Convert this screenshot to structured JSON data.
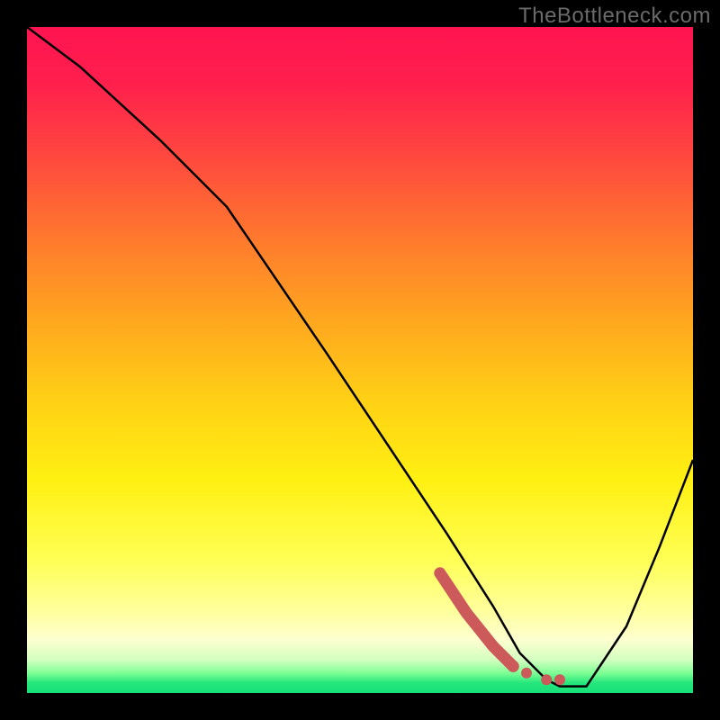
{
  "watermark": "TheBottleneck.com",
  "chart_data": {
    "type": "line",
    "title": "",
    "xlabel": "",
    "ylabel": "",
    "xlim": [
      0,
      100
    ],
    "ylim": [
      0,
      100
    ],
    "series": [
      {
        "name": "curve",
        "x": [
          0,
          8,
          20,
          30,
          45,
          55,
          63,
          70,
          74,
          78,
          80,
          84,
          90,
          95,
          100
        ],
        "y": [
          100,
          94,
          83,
          73,
          51,
          36,
          24,
          13,
          6,
          2,
          1,
          1,
          10,
          22,
          35
        ]
      }
    ],
    "highlight": {
      "name": "dashed-segment",
      "x": [
        62,
        66,
        70,
        73,
        75,
        78,
        80
      ],
      "y": [
        18,
        12,
        7,
        4,
        3,
        2,
        2
      ]
    },
    "colors": {
      "curve": "#000000",
      "highlight": "#cc5a5a"
    }
  }
}
